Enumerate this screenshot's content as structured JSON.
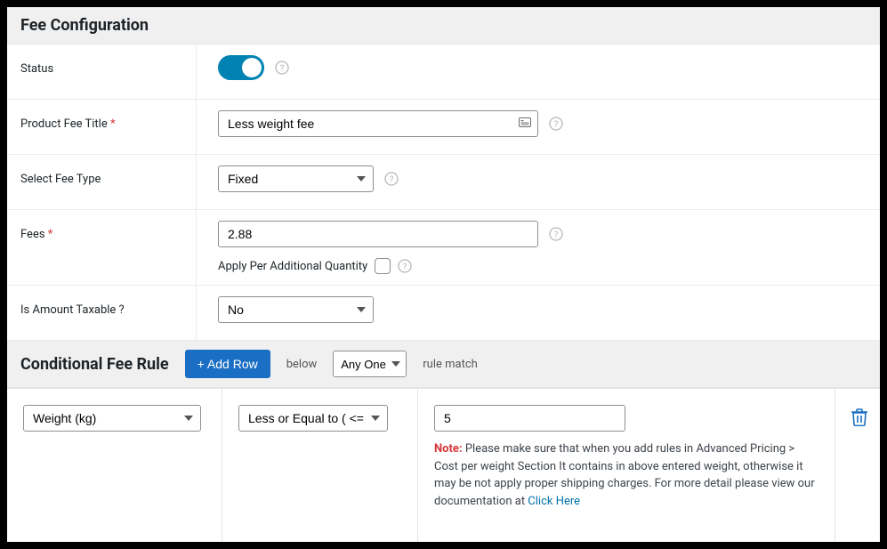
{
  "section1_title": "Fee Configuration",
  "status": {
    "label": "Status",
    "enabled": true
  },
  "product_fee_title": {
    "label": "Product Fee Title",
    "required": "*",
    "value": "Less weight fee"
  },
  "fee_type": {
    "label": "Select Fee Type",
    "value": "Fixed"
  },
  "fees": {
    "label": "Fees",
    "required": "*",
    "value": "2.88",
    "checkbox_label": "Apply Per Additional Quantity"
  },
  "taxable": {
    "label": "Is Amount Taxable ?",
    "value": "No"
  },
  "section2_title": "Conditional Fee Rule",
  "add_row_label": "+ Add Row",
  "below_text": "below",
  "any_one_value": "Any One",
  "rule_match_text": "rule match",
  "rule": {
    "condition": "Weight (kg)",
    "operator": "Less or Equal to ( <= )",
    "value": "5",
    "note_label": "Note:",
    "note_text": " Please make sure that when you add rules in Advanced Pricing > Cost per weight Section It contains in above entered weight, otherwise it may be not apply proper shipping charges. For more detail please view our documentation at ",
    "note_link": "Click Here"
  }
}
